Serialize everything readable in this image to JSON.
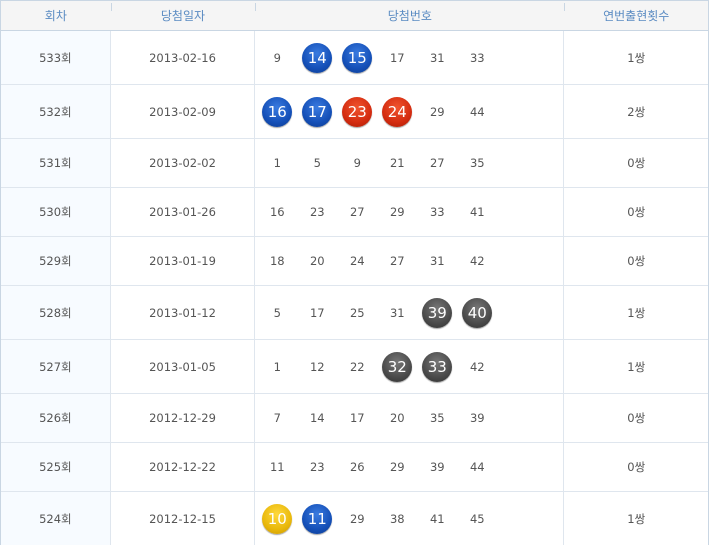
{
  "header": {
    "round": "회차",
    "date": "당첨일자",
    "numbers": "당첨번호",
    "consec": "연번출현횟수"
  },
  "colors": {
    "blue": "#1550b8",
    "red": "#d42c10",
    "gray": "#4a4a4a",
    "yellow": "#e9b80b",
    "header_text": "#5a8bc2"
  },
  "rows": [
    {
      "round": "533회",
      "date": "2013-02-16",
      "consec": "1쌍",
      "numbers": [
        {
          "v": "9",
          "ball": ""
        },
        {
          "v": "14",
          "ball": "blue"
        },
        {
          "v": "15",
          "ball": "blue"
        },
        {
          "v": "17",
          "ball": ""
        },
        {
          "v": "31",
          "ball": ""
        },
        {
          "v": "33",
          "ball": ""
        }
      ]
    },
    {
      "round": "532회",
      "date": "2013-02-09",
      "consec": "2쌍",
      "numbers": [
        {
          "v": "16",
          "ball": "blue"
        },
        {
          "v": "17",
          "ball": "blue"
        },
        {
          "v": "23",
          "ball": "red"
        },
        {
          "v": "24",
          "ball": "red"
        },
        {
          "v": "29",
          "ball": ""
        },
        {
          "v": "44",
          "ball": ""
        }
      ]
    },
    {
      "round": "531회",
      "date": "2013-02-02",
      "consec": "0쌍",
      "numbers": [
        {
          "v": "1",
          "ball": ""
        },
        {
          "v": "5",
          "ball": ""
        },
        {
          "v": "9",
          "ball": ""
        },
        {
          "v": "21",
          "ball": ""
        },
        {
          "v": "27",
          "ball": ""
        },
        {
          "v": "35",
          "ball": ""
        }
      ]
    },
    {
      "round": "530회",
      "date": "2013-01-26",
      "consec": "0쌍",
      "numbers": [
        {
          "v": "16",
          "ball": ""
        },
        {
          "v": "23",
          "ball": ""
        },
        {
          "v": "27",
          "ball": ""
        },
        {
          "v": "29",
          "ball": ""
        },
        {
          "v": "33",
          "ball": ""
        },
        {
          "v": "41",
          "ball": ""
        }
      ]
    },
    {
      "round": "529회",
      "date": "2013-01-19",
      "consec": "0쌍",
      "numbers": [
        {
          "v": "18",
          "ball": ""
        },
        {
          "v": "20",
          "ball": ""
        },
        {
          "v": "24",
          "ball": ""
        },
        {
          "v": "27",
          "ball": ""
        },
        {
          "v": "31",
          "ball": ""
        },
        {
          "v": "42",
          "ball": ""
        }
      ]
    },
    {
      "round": "528회",
      "date": "2013-01-12",
      "consec": "1쌍",
      "numbers": [
        {
          "v": "5",
          "ball": ""
        },
        {
          "v": "17",
          "ball": ""
        },
        {
          "v": "25",
          "ball": ""
        },
        {
          "v": "31",
          "ball": ""
        },
        {
          "v": "39",
          "ball": "gray"
        },
        {
          "v": "40",
          "ball": "gray"
        }
      ]
    },
    {
      "round": "527회",
      "date": "2013-01-05",
      "consec": "1쌍",
      "numbers": [
        {
          "v": "1",
          "ball": ""
        },
        {
          "v": "12",
          "ball": ""
        },
        {
          "v": "22",
          "ball": ""
        },
        {
          "v": "32",
          "ball": "gray"
        },
        {
          "v": "33",
          "ball": "gray"
        },
        {
          "v": "42",
          "ball": ""
        }
      ]
    },
    {
      "round": "526회",
      "date": "2012-12-29",
      "consec": "0쌍",
      "numbers": [
        {
          "v": "7",
          "ball": ""
        },
        {
          "v": "14",
          "ball": ""
        },
        {
          "v": "17",
          "ball": ""
        },
        {
          "v": "20",
          "ball": ""
        },
        {
          "v": "35",
          "ball": ""
        },
        {
          "v": "39",
          "ball": ""
        }
      ]
    },
    {
      "round": "525회",
      "date": "2012-12-22",
      "consec": "0쌍",
      "numbers": [
        {
          "v": "11",
          "ball": ""
        },
        {
          "v": "23",
          "ball": ""
        },
        {
          "v": "26",
          "ball": ""
        },
        {
          "v": "29",
          "ball": ""
        },
        {
          "v": "39",
          "ball": ""
        },
        {
          "v": "44",
          "ball": ""
        }
      ]
    },
    {
      "round": "524회",
      "date": "2012-12-15",
      "consec": "1쌍",
      "numbers": [
        {
          "v": "10",
          "ball": "yellow"
        },
        {
          "v": "11",
          "ball": "blue"
        },
        {
          "v": "29",
          "ball": ""
        },
        {
          "v": "38",
          "ball": ""
        },
        {
          "v": "41",
          "ball": ""
        },
        {
          "v": "45",
          "ball": ""
        }
      ]
    }
  ]
}
